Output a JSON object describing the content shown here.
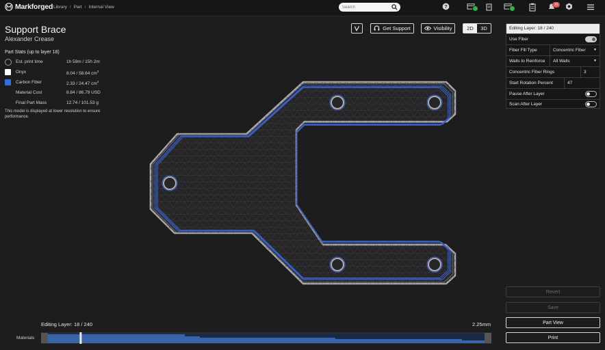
{
  "header": {
    "brand": "Markforged",
    "breadcrumbs": [
      "Library",
      "Part",
      "Internal View"
    ],
    "search_placeholder": "Search",
    "notification_count": "10"
  },
  "part": {
    "name": "Support Brace",
    "owner": "Alexander Crease"
  },
  "stats": {
    "heading": "Part Stats (up to layer 18)",
    "rows": [
      {
        "label": "Est. print time",
        "value": "1h 59m / 15h 2m"
      },
      {
        "label": "Onyx",
        "value": "8.04 / 58.64 cm",
        "unit_sup": "3"
      },
      {
        "label": "Carbon Fiber",
        "value": "2.33 / 24.47 cm",
        "unit_sup": "3"
      },
      {
        "label": "Material Cost",
        "value": "8.84 / 86.79 USD"
      },
      {
        "label": "Final Part Mass",
        "value": "12.74 / 101.53 g"
      }
    ],
    "note": "This model is displayed at lower resolution to ensure performance."
  },
  "toolbar": {
    "support_label": "Get Support",
    "visibility_label": "Visibility",
    "view_2d": "2D",
    "view_3d": "3D",
    "active_view": "2D"
  },
  "layer_panel": {
    "title": "Editing Layer: 18 / 240",
    "use_fiber_label": "Use Fiber",
    "use_fiber_on": true,
    "fiber_fill_type_label": "Fiber Fill Type",
    "fiber_fill_type_value": "Concentric Fiber",
    "walls_label": "Walls to Reinforce",
    "walls_value": "All Walls",
    "rings_label": "Concentric Fiber Rings",
    "rings_value": "3",
    "rotation_label": "Start Rotation Percent",
    "rotation_value": "47",
    "pause_label": "Pause After Layer",
    "pause_on": false,
    "scan_label": "Scan After Layer",
    "scan_on": false
  },
  "actions": {
    "revert": "Revert",
    "save": "Save",
    "part_view": "Part View",
    "print": "Print"
  },
  "timeline": {
    "layer_label": "Editing Layer: 18 / 240",
    "height_label": "2.25mm",
    "materials_label": "Materials",
    "current_layer": 18,
    "total_layers": 240
  },
  "colors": {
    "onyx": "#ffffff",
    "carbon_fiber": "#2f6fe0",
    "fiber_path": "#3a63d6",
    "wall": "#9a9a9a",
    "success": "#2fb344",
    "alert": "#d9534f"
  },
  "icons": [
    "markforged-logo-icon",
    "search-icon",
    "help-icon",
    "printer-status-icon",
    "document-icon",
    "printer-status-icon",
    "clipboard-icon",
    "bell-icon",
    "settings-icon",
    "menu-icon",
    "fiber-path-icon",
    "headset-icon",
    "eye-icon",
    "clock-icon"
  ]
}
